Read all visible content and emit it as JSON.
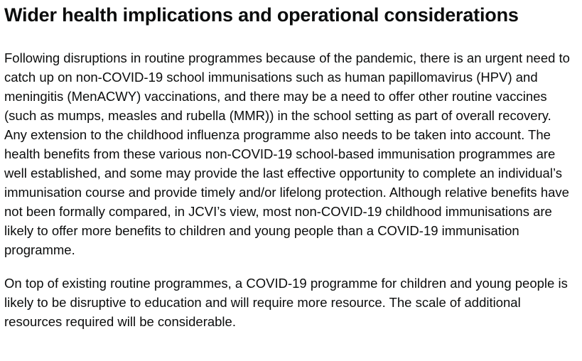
{
  "section": {
    "heading": "Wider health implications and operational considerations",
    "paragraphs": [
      "Following disruptions in routine programmes because of the pandemic, there is an urgent need to catch up on non-COVID-19 school immunisations such as human papillomavirus (HPV) and meningitis (MenACWY) vaccinations, and there may be a need to offer other routine vaccines (such as mumps, measles and rubella (MMR)) in the school setting as part of overall recovery. Any extension to the childhood influenza programme also needs to be taken into account. The health benefits from these various non-COVID-19 school-based immunisation programmes are well established, and some may provide the last effective opportunity to complete an individual’s immunisation course and provide timely and/or lifelong protection. Although relative benefits have not been formally compared, in JCVI’s view, most non-COVID-19 childhood immunisations are likely to offer more benefits to children and young people than a COVID-19 immunisation programme.",
      "On top of existing routine programmes, a COVID-19 programme for children and young people is likely to be disruptive to education and will require more resource. The scale of additional resources required will be considerable."
    ]
  }
}
